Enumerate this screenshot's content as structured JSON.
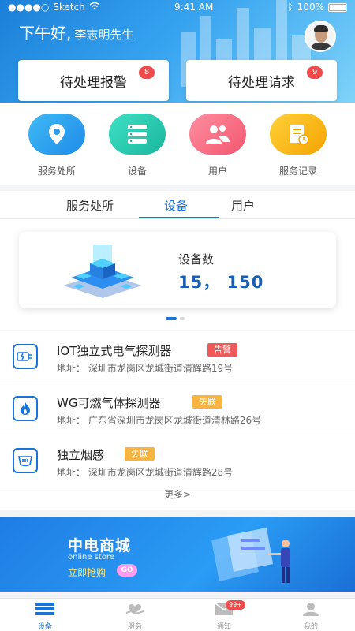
{
  "status_bar": {
    "carrier": "Sketch",
    "time": "9:41 AM",
    "battery": "100%"
  },
  "header": {
    "greeting": "下午好,",
    "user_name": "李志明先生"
  },
  "pending": {
    "alarm": {
      "label": "待处理报警",
      "count": "8"
    },
    "request": {
      "label": "待处理请求",
      "count": "9"
    }
  },
  "quick_actions": [
    {
      "label": "服务处所",
      "icon": "location-pin-icon"
    },
    {
      "label": "设备",
      "icon": "server-icon"
    },
    {
      "label": "用户",
      "icon": "users-icon"
    },
    {
      "label": "服务记录",
      "icon": "record-icon"
    }
  ],
  "tabs": [
    {
      "label": "服务处所"
    },
    {
      "label": "设备"
    },
    {
      "label": "用户"
    }
  ],
  "active_tab": "设备",
  "stat_card": {
    "label": "设备数",
    "value": "15， 150"
  },
  "devices": [
    {
      "name": "IOT独立式电气探测器",
      "status": "告警",
      "address": "地址： 深圳市龙岗区龙城街道清辉路19号",
      "icon": "electric-plug-icon"
    },
    {
      "name": "WG可燃气体探测器",
      "status": "失联",
      "address": "地址： 广东省深圳市龙岗区龙城街道清林路26号",
      "icon": "flame-icon"
    },
    {
      "name": "独立烟感",
      "status": "失联",
      "address": "地址： 深圳市龙岗区龙城街道清辉路28号",
      "icon": "smoke-detector-icon"
    }
  ],
  "more_label": "更多>",
  "banner": {
    "title": "中电商城",
    "subtitle": "online store",
    "cta": "立即抢购",
    "go": "GO"
  },
  "bottom_nav": [
    {
      "label": "设备",
      "icon": "device-icon",
      "active": true
    },
    {
      "label": "服务",
      "icon": "service-icon",
      "active": false
    },
    {
      "label": "通知",
      "icon": "mail-icon",
      "badge": "99+",
      "active": false
    },
    {
      "label": "我的",
      "icon": "profile-icon",
      "active": false
    }
  ],
  "colors": {
    "primary": "#1a73d9",
    "alert": "#f25a5a",
    "offline": "#f8b440"
  }
}
